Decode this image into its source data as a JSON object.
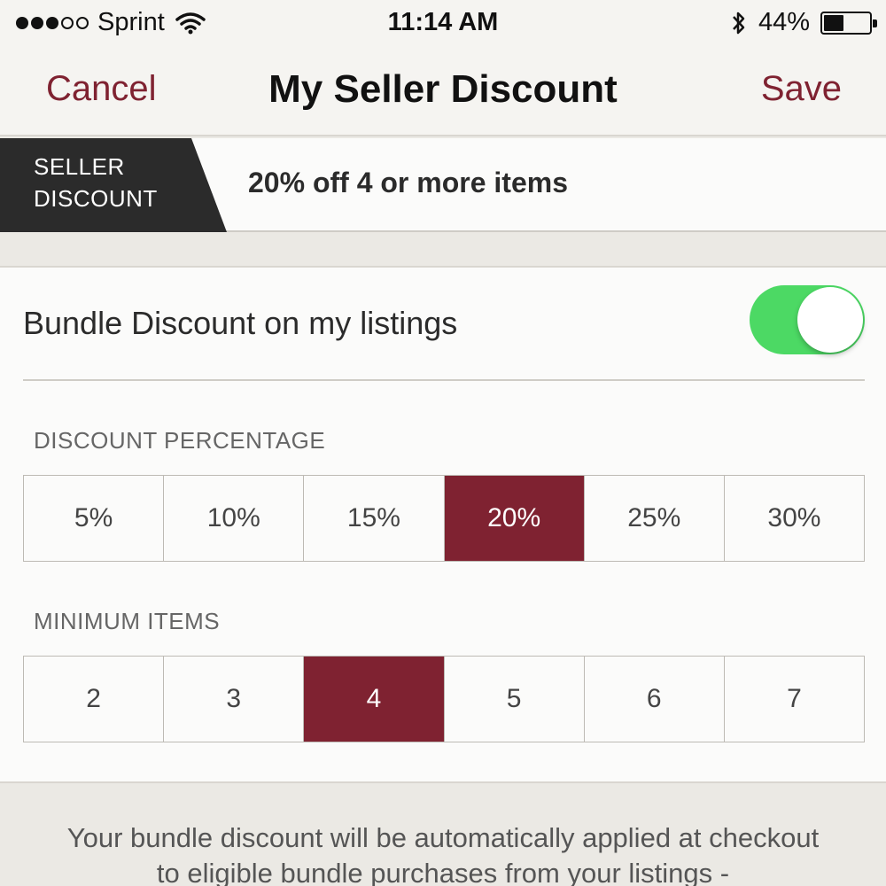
{
  "status_bar": {
    "carrier": "Sprint",
    "time": "11:14 AM",
    "battery": "44%",
    "battery_level": 0.44,
    "signal_bars_filled": 3,
    "signal_bars_total": 5
  },
  "nav": {
    "cancel_label": "Cancel",
    "title": "My Seller Discount",
    "save_label": "Save"
  },
  "summary": {
    "tag_line1": "SELLER",
    "tag_line2": "DISCOUNT",
    "text": "20% off 4 or more items"
  },
  "bundle": {
    "label": "Bundle Discount on my listings",
    "enabled": true
  },
  "discount_percentage": {
    "label": "DISCOUNT PERCENTAGE",
    "options": [
      "5%",
      "10%",
      "15%",
      "20%",
      "25%",
      "30%"
    ],
    "selected": "20%"
  },
  "minimum_items": {
    "label": "MINIMUM ITEMS",
    "options": [
      "2",
      "3",
      "4",
      "5",
      "6",
      "7"
    ],
    "selected": "4"
  },
  "footer": {
    "note": "Your bundle discount will be automatically applied at checkout to eligible bundle purchases from your listings -"
  },
  "colors": {
    "accent": "#7f2231",
    "toggle_on": "#4cd964",
    "tag_bg": "#2b2b2b"
  },
  "icons": [
    "wifi-icon",
    "bluetooth-icon",
    "battery-icon"
  ]
}
